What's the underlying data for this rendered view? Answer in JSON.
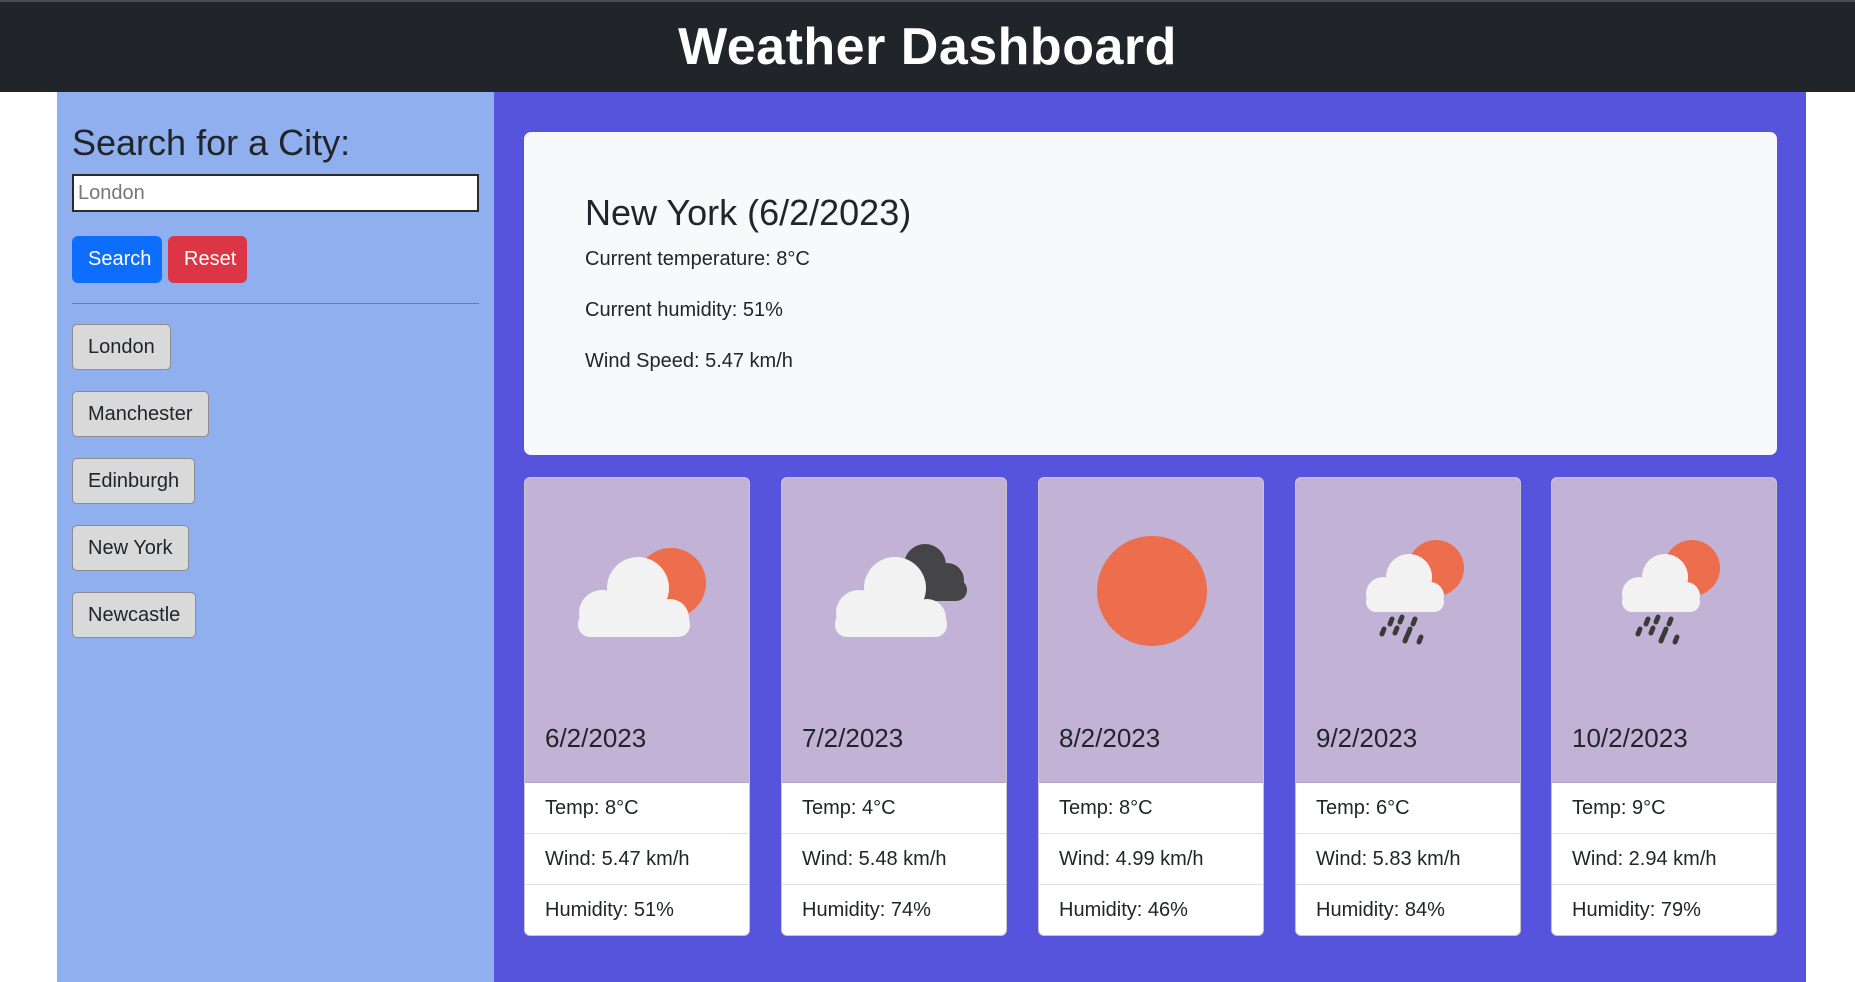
{
  "header": {
    "title": "Weather Dashboard"
  },
  "sidebar": {
    "heading": "Search for a City:",
    "search_placeholder": "London",
    "search_value": "",
    "search_label": "Search",
    "reset_label": "Reset",
    "history": [
      "London",
      "Manchester",
      "Edinburgh",
      "New York",
      "Newcastle"
    ]
  },
  "current": {
    "title": "New York (6/2/2023)",
    "temperature": "Current temperature: 8°C",
    "humidity": "Current humidity: 51%",
    "wind": "Wind Speed: 5.47 km/h"
  },
  "forecast": [
    {
      "date": "6/2/2023",
      "icon": "partly-cloudy-sun-icon",
      "temp": "Temp: 8°C",
      "wind": "Wind: 5.47 km/h",
      "humidity": "Humidity: 51%"
    },
    {
      "date": "7/2/2023",
      "icon": "dark-clouds-icon",
      "temp": "Temp: 4°C",
      "wind": "Wind: 5.48 km/h",
      "humidity": "Humidity: 74%"
    },
    {
      "date": "8/2/2023",
      "icon": "sun-icon",
      "temp": "Temp: 8°C",
      "wind": "Wind: 4.99 km/h",
      "humidity": "Humidity: 46%"
    },
    {
      "date": "9/2/2023",
      "icon": "rain-sun-icon",
      "temp": "Temp: 6°C",
      "wind": "Wind: 5.83 km/h",
      "humidity": "Humidity: 84%"
    },
    {
      "date": "10/2/2023",
      "icon": "rain-sun-icon",
      "temp": "Temp: 9°C",
      "wind": "Wind: 2.94 km/h",
      "humidity": "Humidity: 79%"
    }
  ],
  "colors": {
    "header_bg": "#212529",
    "sidebar_bg": "#8fafef",
    "main_bg": "#5653dc",
    "card_top_bg": "#c2b3d6",
    "search_button": "#0d6efd",
    "reset_button": "#dc3545",
    "sun": "#ec6e4c",
    "cloud_light": "#f2f2f2",
    "cloud_dark": "#454547"
  }
}
